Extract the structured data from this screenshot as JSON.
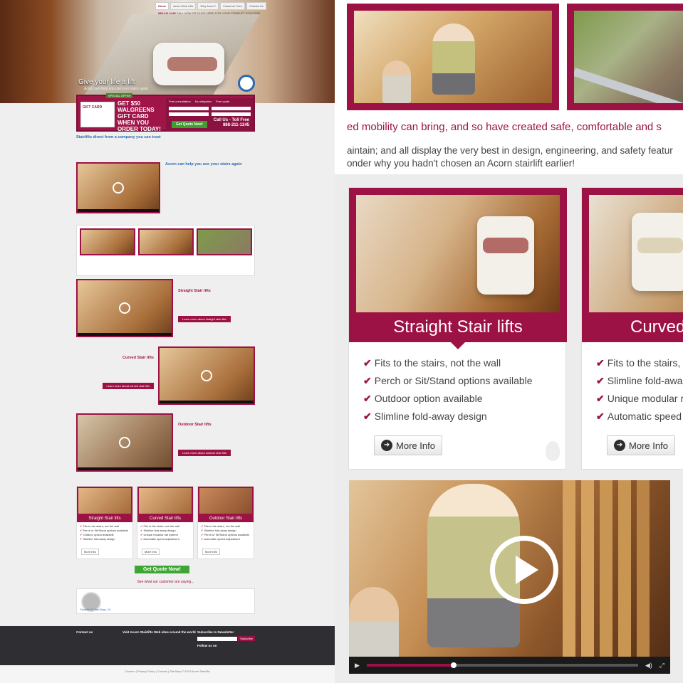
{
  "left": {
    "nav": [
      "Home",
      "Acorn Stair Lifts",
      "Why Acorn?",
      "Customer Care",
      "Contact Us"
    ],
    "phone_number": "888-211-1245",
    "phone_text": "CALL NOW OR CLICK HERE FOR YOUR STAIRLIFT SOLUTION",
    "hero_title": "Give your life a lift",
    "hero_sub": "Acorn can help you use your stairs again",
    "offer": {
      "label": "SPECIAL OFFER",
      "gift": "GIFT CARD",
      "promo": "GET $50 WALGREENS GIFT CARD WHEN YOU ORDER TODAY!",
      "checks": [
        "Free consultation",
        "No obligation",
        "Free quote"
      ],
      "cta": "Get Quote Now!",
      "call": "Call Us - Toll Free",
      "call_number": "888-211-1245"
    },
    "intro_title": "Stairlifts direct from a company you can trust",
    "video_title": "Acorn can help you use your stairs again",
    "sections": [
      {
        "title": "Straight Stair lifts",
        "btn": "Learn more about straight stair lifts"
      },
      {
        "title": "Curved Stair lifts",
        "btn": "Learn more about curved stair lifts"
      },
      {
        "title": "Outdoor Stair lifts",
        "btn": "Learn more about outdoor stair lifts"
      }
    ],
    "cards": [
      {
        "label": "Straight Stair lifts",
        "items": [
          "Fits to the stairs, not the wall",
          "Perch or Sit/Stand options available",
          "Outdoor option available",
          "Slimline fold-away design"
        ]
      },
      {
        "label": "Curved Stair lifts",
        "items": [
          "Fits to the stairs, not the wall",
          "Slimline fold-away design",
          "Unique modular rail system",
          "Automatic speed adjustment"
        ]
      },
      {
        "label": "Outdoor Stair lifts",
        "items": [
          "Fits to the stairs, not the wall",
          "Slimline fold-away design",
          "Perch or Sit/Stand options available",
          "Automatic speed adjustment"
        ]
      }
    ],
    "more_info": "More Info",
    "quote_btn": "Get Quote Now!",
    "testimonial_head": "See what our customer are saying...",
    "testimonial_name": "Geraldine S, San Diego, CA",
    "footer": {
      "contact": "Contact us",
      "sites": "Visit Acorn Stairlifts Web sites around the world",
      "newsletter": "Subscribe to Newsletter",
      "subscribe": "Subscribe",
      "follow": "Follow us on",
      "copyright": "Careers | Privacy Policy | Contact | Site Map    © 2013 Acorn Stairlifts"
    }
  },
  "right": {
    "tagline": "ed mobility can bring, and so have created safe, comfortable and s",
    "body_line1": "aintain; and all display the very best in design, engineering, and safety featur",
    "body_line2": "onder why you hadn't chosen an Acorn stairlift earlier!",
    "cards": [
      {
        "label": "Straight Stair lifts",
        "items": [
          "Fits to the stairs, not the wall",
          "Perch or Sit/Stand options available",
          "Outdoor option available",
          "Slimline fold-away design"
        ]
      },
      {
        "label": "Curved",
        "items": [
          "Fits to the stairs, n",
          "Slimline fold-awa",
          "Unique modular r",
          "Automatic speed"
        ]
      }
    ],
    "more_info": "More Info",
    "video": {
      "progress": 0.32
    }
  },
  "colors": {
    "brand": "#9d1244",
    "cta_green": "#3ea632",
    "link_blue": "#2a6ab1"
  }
}
